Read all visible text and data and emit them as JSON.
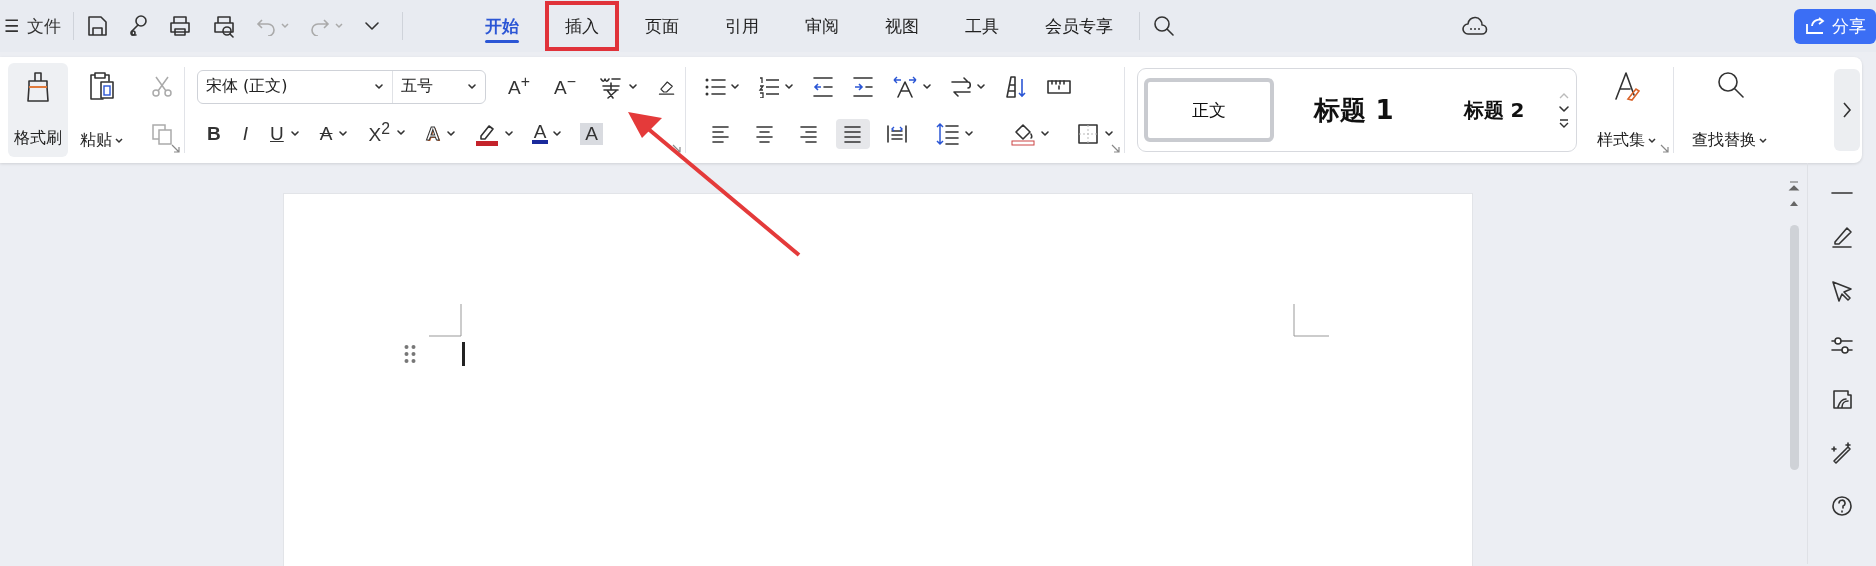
{
  "title_bar": {
    "menu_icon": "☰",
    "file_label": "文件"
  },
  "tabs": [
    {
      "label": "开始",
      "selected": true,
      "highlighted": false
    },
    {
      "label": "插入",
      "selected": false,
      "highlighted": true
    },
    {
      "label": "页面",
      "selected": false,
      "highlighted": false
    },
    {
      "label": "引用",
      "selected": false,
      "highlighted": false
    },
    {
      "label": "审阅",
      "selected": false,
      "highlighted": false
    },
    {
      "label": "视图",
      "selected": false,
      "highlighted": false
    },
    {
      "label": "工具",
      "selected": false,
      "highlighted": false
    },
    {
      "label": "会员专享",
      "selected": false,
      "highlighted": false
    }
  ],
  "share_button": "分享",
  "ribbon": {
    "format_painter": "格式刷",
    "paste": "粘贴",
    "font_name": "宋体 (正文)",
    "font_size": "五号",
    "grow_font": "A$^{+}$",
    "shrink_font": "A$^{−}$",
    "font_buttons": [
      {
        "kind": "bold",
        "glyph": "B"
      },
      {
        "kind": "italic",
        "glyph": "I"
      },
      {
        "kind": "underline",
        "glyph": "U"
      },
      {
        "kind": "strike",
        "glyph": "A"
      },
      {
        "kind": "superscript",
        "glyph": "X$^{2}$"
      },
      {
        "kind": "effect",
        "glyph": "A"
      },
      {
        "kind": "highlight"
      },
      {
        "kind": "font_color",
        "glyph": "A"
      },
      {
        "kind": "shading",
        "glyph": "A"
      }
    ],
    "alignments": [
      {
        "kind": "left",
        "selected": false
      },
      {
        "kind": "center",
        "selected": false
      },
      {
        "kind": "right",
        "selected": false
      },
      {
        "kind": "justify",
        "selected": true
      },
      {
        "kind": "distributed",
        "selected": false
      }
    ],
    "styles": [
      {
        "label": "正文",
        "selected": true,
        "kind": "body"
      },
      {
        "label": "标题 1",
        "selected": false,
        "kind": "heading1"
      },
      {
        "label": "标题 2",
        "selected": false,
        "kind": "heading2"
      }
    ],
    "style_set": "样式集",
    "find_replace": "查找替换"
  },
  "annotation": {
    "arrow_visible": true
  }
}
